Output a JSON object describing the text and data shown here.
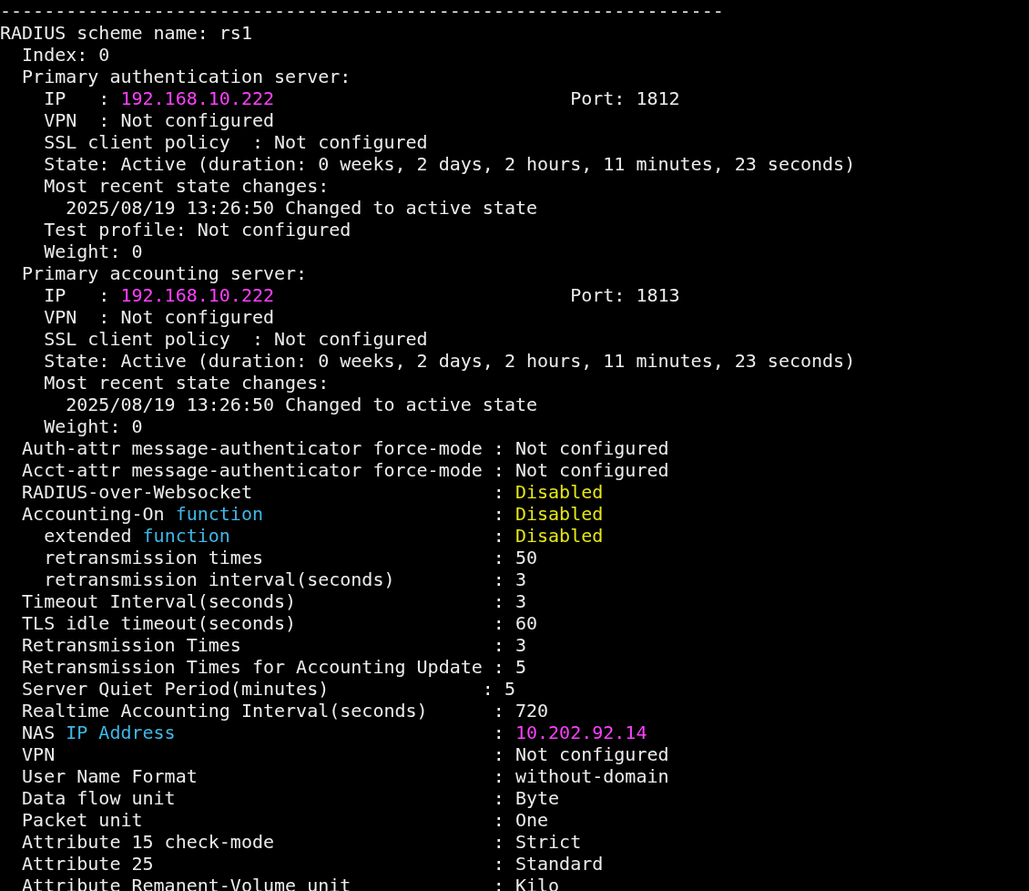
{
  "lines": [
    {
      "segments": [
        {
          "text": "------------------------------------------------------------------"
        }
      ]
    },
    {
      "segments": [
        {
          "text": "RADIUS scheme name: rs1"
        }
      ]
    },
    {
      "segments": [
        {
          "text": "  Index: 0"
        }
      ]
    },
    {
      "segments": [
        {
          "text": "  Primary authentication server:"
        }
      ]
    },
    {
      "segments": [
        {
          "text": "    IP   : "
        },
        {
          "text": "192.168.10.222",
          "kind": "address"
        },
        {
          "text": "                           Port: 1812"
        }
      ]
    },
    {
      "segments": [
        {
          "text": "    VPN  : Not configured"
        }
      ]
    },
    {
      "segments": [
        {
          "text": "    SSL client policy  : Not configured"
        }
      ]
    },
    {
      "segments": [
        {
          "text": "    State: Active (duration: 0 weeks, 2 days, 2 hours, 11 minutes, 23 seconds)"
        }
      ]
    },
    {
      "segments": [
        {
          "text": "    Most recent state changes:"
        }
      ]
    },
    {
      "segments": [
        {
          "text": "      2025/08/19 13:26:50 Changed to active state"
        }
      ]
    },
    {
      "segments": [
        {
          "text": "    Test profile: Not configured"
        }
      ]
    },
    {
      "segments": [
        {
          "text": "    Weight: 0"
        }
      ]
    },
    {
      "segments": [
        {
          "text": "  Primary accounting server:"
        }
      ]
    },
    {
      "segments": [
        {
          "text": "    IP   : "
        },
        {
          "text": "192.168.10.222",
          "kind": "address"
        },
        {
          "text": "                           Port: 1813"
        }
      ]
    },
    {
      "segments": [
        {
          "text": "    VPN  : Not configured"
        }
      ]
    },
    {
      "segments": [
        {
          "text": "    SSL client policy  : Not configured"
        }
      ]
    },
    {
      "segments": [
        {
          "text": "    State: Active (duration: 0 weeks, 2 days, 2 hours, 11 minutes, 23 seconds)"
        }
      ]
    },
    {
      "segments": [
        {
          "text": "    Most recent state changes:"
        }
      ]
    },
    {
      "segments": [
        {
          "text": "      2025/08/19 13:26:50 Changed to active state"
        }
      ]
    },
    {
      "segments": [
        {
          "text": "    Weight: 0"
        }
      ]
    },
    {
      "segments": [
        {
          "text": "  Auth-attr message-authenticator force-mode : Not configured"
        }
      ]
    },
    {
      "segments": [
        {
          "text": "  Acct-attr message-authenticator force-mode : Not configured"
        }
      ]
    },
    {
      "segments": [
        {
          "text": "  RADIUS-over-Websocket                      : "
        },
        {
          "text": "Disabled",
          "kind": "status"
        }
      ]
    },
    {
      "segments": [
        {
          "text": "  Accounting-On "
        },
        {
          "text": "function",
          "kind": "keyword"
        },
        {
          "text": "                     : "
        },
        {
          "text": "Disabled",
          "kind": "status"
        }
      ]
    },
    {
      "segments": [
        {
          "text": "    extended "
        },
        {
          "text": "function",
          "kind": "keyword"
        },
        {
          "text": "                        : "
        },
        {
          "text": "Disabled",
          "kind": "status"
        }
      ]
    },
    {
      "segments": [
        {
          "text": "    retransmission times                     : 50"
        }
      ]
    },
    {
      "segments": [
        {
          "text": "    retransmission interval(seconds)         : 3"
        }
      ]
    },
    {
      "segments": [
        {
          "text": "  Timeout Interval(seconds)                  : 3"
        }
      ]
    },
    {
      "segments": [
        {
          "text": "  TLS idle timeout(seconds)                  : 60"
        }
      ]
    },
    {
      "segments": [
        {
          "text": "  Retransmission Times                       : 3"
        }
      ]
    },
    {
      "segments": [
        {
          "text": "  Retransmission Times for Accounting Update : 5"
        }
      ]
    },
    {
      "segments": [
        {
          "text": "  Server Quiet Period(minutes)              : 5"
        }
      ]
    },
    {
      "segments": [
        {
          "text": "  Realtime Accounting Interval(seconds)      : 720"
        }
      ]
    },
    {
      "segments": [
        {
          "text": "  NAS "
        },
        {
          "text": "IP Address",
          "kind": "keyword"
        },
        {
          "text": "                             : "
        },
        {
          "text": "10.202.92.14",
          "kind": "address"
        }
      ]
    },
    {
      "segments": [
        {
          "text": "  VPN                                        : Not configured"
        }
      ]
    },
    {
      "segments": [
        {
          "text": "  User Name Format                           : without-domain"
        }
      ]
    },
    {
      "segments": [
        {
          "text": "  Data flow unit                             : Byte"
        }
      ]
    },
    {
      "segments": [
        {
          "text": "  Packet unit                                : One"
        }
      ]
    },
    {
      "segments": [
        {
          "text": "  Attribute 15 check-mode                    : Strict"
        }
      ]
    },
    {
      "segments": [
        {
          "text": "  Attribute 25                               : Standard"
        }
      ]
    },
    {
      "segments": [
        {
          "text": "  Attribute Remanent-Volume unit             : Kilo"
        }
      ]
    }
  ]
}
